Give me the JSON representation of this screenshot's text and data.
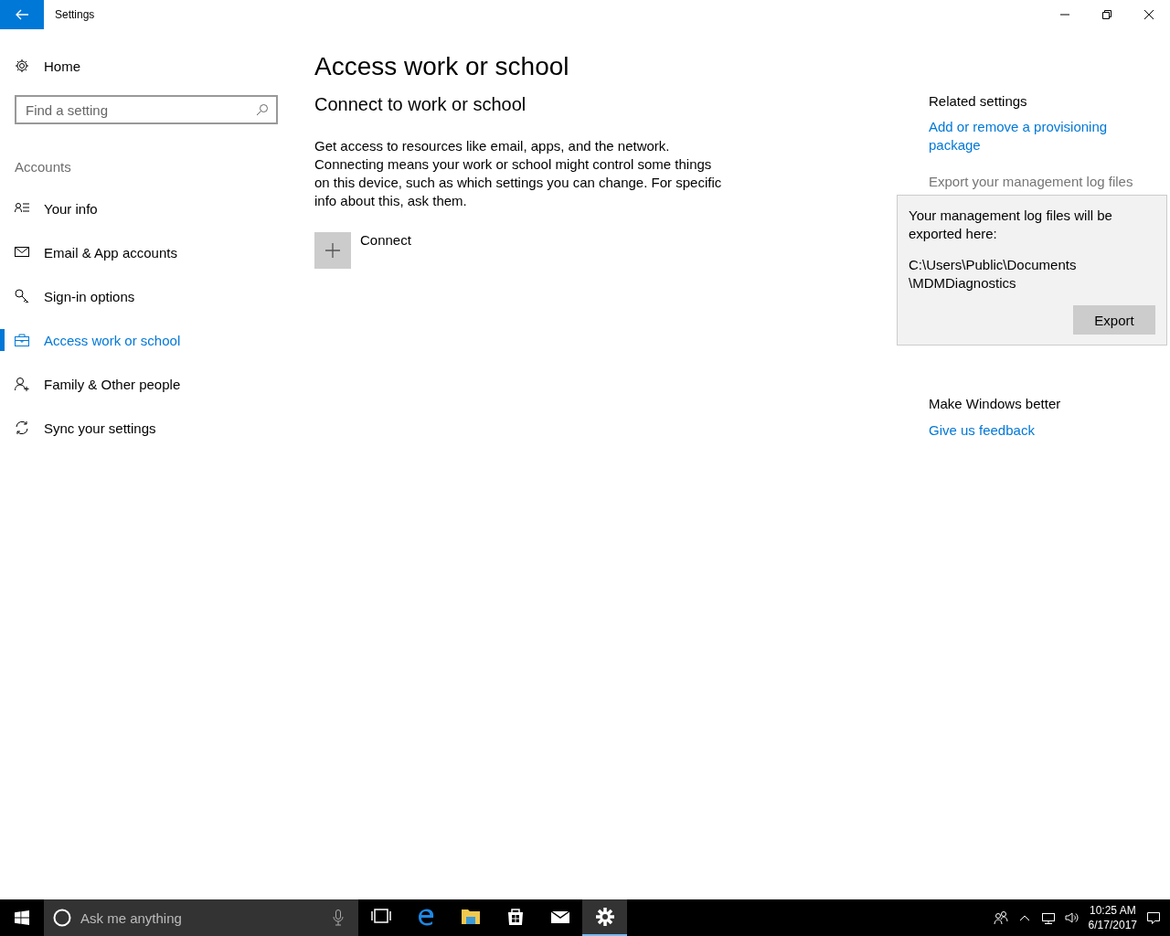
{
  "window": {
    "title": "Settings"
  },
  "sidebar": {
    "home": "Home",
    "search": {
      "placeholder": "Find a setting"
    },
    "section": "Accounts",
    "items": [
      {
        "label": "Your info",
        "selected": false
      },
      {
        "label": "Email & App accounts",
        "selected": false
      },
      {
        "label": "Sign-in options",
        "selected": false
      },
      {
        "label": "Access work or school",
        "selected": true
      },
      {
        "label": "Family & Other people",
        "selected": false
      },
      {
        "label": "Sync your settings",
        "selected": false
      }
    ]
  },
  "page": {
    "title": "Access work or school",
    "heading": "Connect to work or school",
    "description": "Get access to resources like email, apps, and the network. Connecting means your work or school might control some things on this device, such as which settings you can change. For specific info about this, ask them.",
    "connect": "Connect"
  },
  "related": {
    "heading": "Related settings",
    "links": [
      "Add or remove a provisioning package"
    ],
    "export_link": "Export your management log files"
  },
  "flyout": {
    "message": "Your management log files will be exported here:",
    "path_lines": [
      "C:\\Users\\Public\\Documents",
      "\\MDMDiagnostics"
    ],
    "button": "Export"
  },
  "feedback": {
    "heading": "Make Windows better",
    "link": "Give us feedback"
  },
  "taskbar": {
    "search": {
      "placeholder": "Ask me anything"
    },
    "apps": [
      {
        "selected": false
      },
      {
        "selected": false
      },
      {
        "selected": false
      },
      {
        "selected": false
      },
      {
        "selected": false
      },
      {
        "selected": true
      }
    ],
    "clock": {
      "time": "10:25 AM",
      "date": "6/17/2017"
    }
  }
}
